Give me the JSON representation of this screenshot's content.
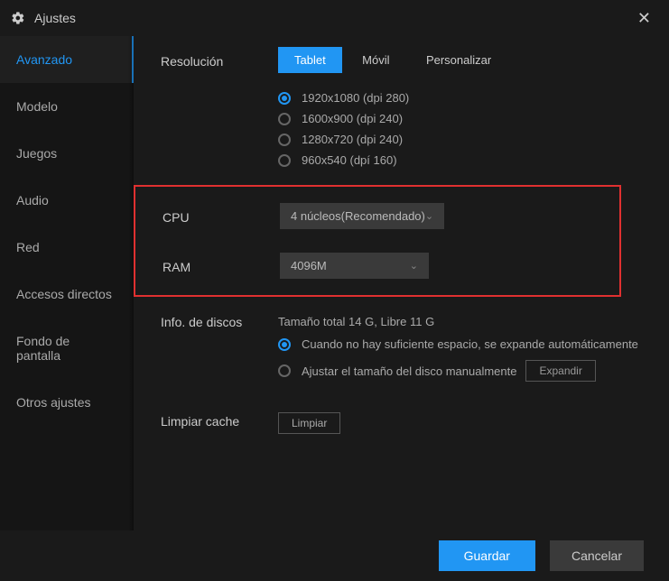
{
  "titlebar": {
    "title": "Ajustes"
  },
  "sidebar": {
    "items": [
      {
        "label": "Avanzado"
      },
      {
        "label": "Modelo"
      },
      {
        "label": "Juegos"
      },
      {
        "label": "Audio"
      },
      {
        "label": "Red"
      },
      {
        "label": "Accesos directos"
      },
      {
        "label": "Fondo de pantalla"
      },
      {
        "label": "Otros ajustes"
      }
    ]
  },
  "resolution": {
    "label": "Resolución",
    "tabs": {
      "tablet": "Tablet",
      "movil": "Móvil",
      "personalizar": "Personalizar"
    },
    "options": [
      "1920x1080  (dpi 280)",
      "1600x900  (dpi 240)",
      "1280x720  (dpi 240)",
      "960x540  (dpí 160)"
    ]
  },
  "cpu": {
    "label": "CPU",
    "value": "4 núcleos(Recomendado)"
  },
  "ram": {
    "label": "RAM",
    "value": "4096M"
  },
  "disk": {
    "label": "Info. de discos",
    "summary": "Tamaño total 14 G,  Libre 11 G",
    "auto": "Cuando no hay suficiente espacio, se expande automáticamente",
    "manual": "Ajustar el tamaño del disco manualmente",
    "expand": "Expandir"
  },
  "cache": {
    "label": "Limpiar cache",
    "button": "Limpiar"
  },
  "footer": {
    "save": "Guardar",
    "cancel": "Cancelar"
  }
}
